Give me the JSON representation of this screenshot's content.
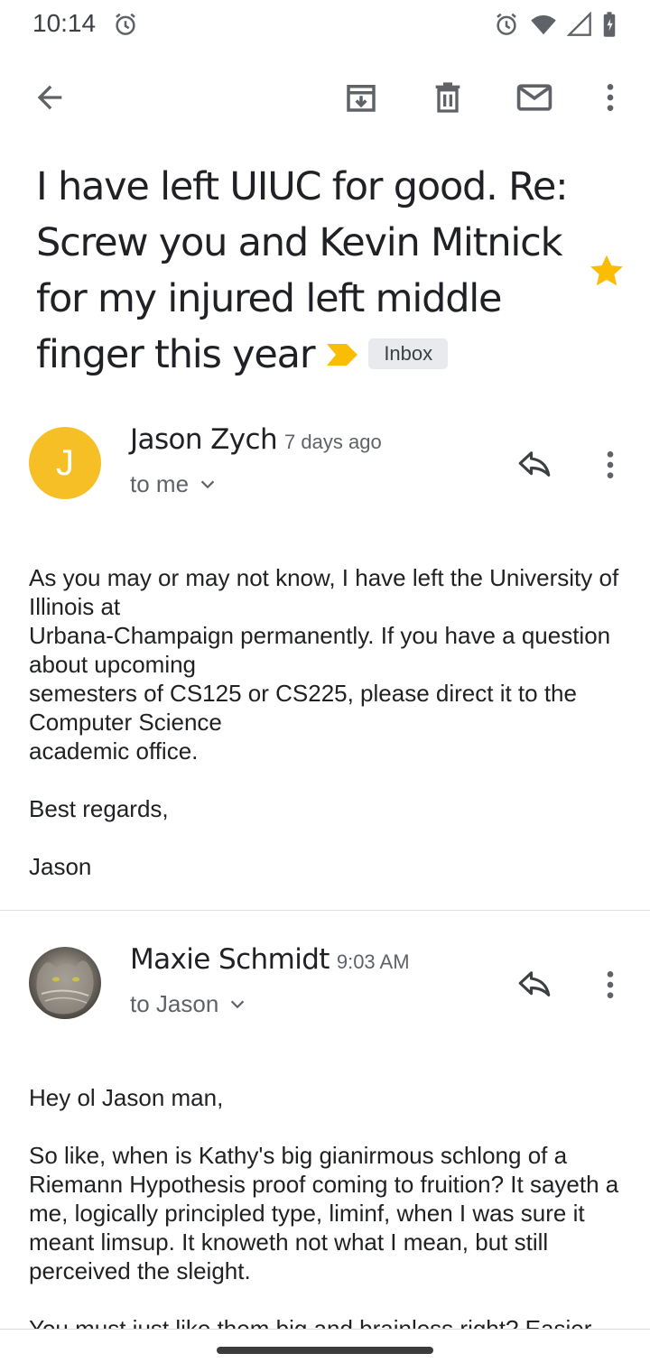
{
  "status_bar": {
    "time": "10:14"
  },
  "toolbar": {
    "back": "back-arrow-icon",
    "archive": "archive-icon",
    "delete": "delete-icon",
    "mark_unread": "mail-icon",
    "more": "more-vert-icon"
  },
  "thread": {
    "subject": "I have left UIUC for good. Re: Screw you and Kevin Mitnick for my injured left middle finger this year",
    "label": "Inbox",
    "starred": true,
    "colors": {
      "star": "#fbbc04",
      "importance": "#fbbc04",
      "avatar_j": "#f6bf26"
    }
  },
  "messages": [
    {
      "avatar_letter": "J",
      "sender": "Jason Zych",
      "time": "7 days ago",
      "recipient": "to me",
      "body": "As you may or may not know, I have left the University of Illinois at\nUrbana-Champaign permanently. If you have a question about upcoming\nsemesters of CS125 or CS225, please direct it to the Computer Science\nacademic office.\n\nBest regards,\n\nJason"
    },
    {
      "sender": "Maxie Schmidt",
      "time": "9:03 AM",
      "recipient": "to Jason",
      "body": "Hey ol Jason man,\n\nSo like, when is Kathy's big gianirmous schlong of a Riemann Hypothesis proof coming to fruition? It sayeth a me, logically principled type, liminf, when I was sure it meant limsup. It knoweth not what I mean, but still perceived the sleight.\n\nYou must just like them big and brainless right? Easier"
    }
  ]
}
